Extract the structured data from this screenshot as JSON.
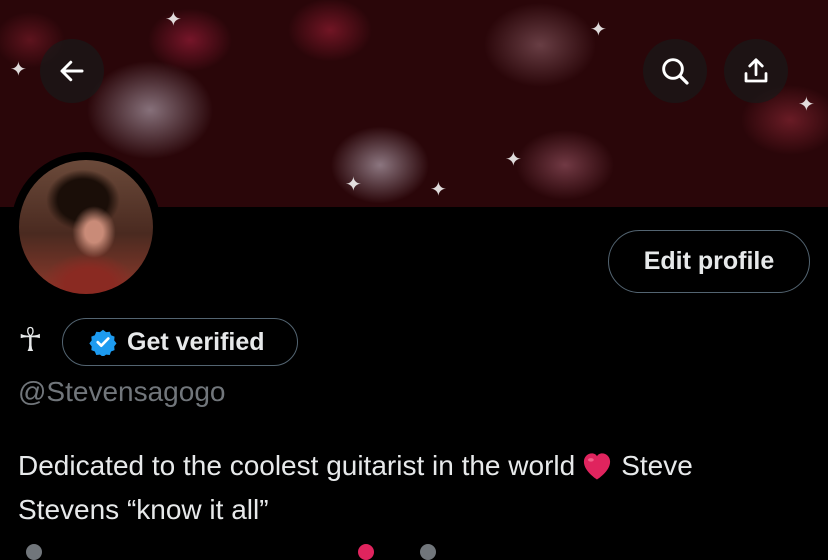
{
  "header": {
    "back_icon": "arrow-left-icon",
    "search_icon": "search-icon",
    "share_icon": "share-icon"
  },
  "profile": {
    "display_name": "☥",
    "verified_button_label": "Get verified",
    "verified_icon": "verified-badge-icon",
    "handle": "@Stevensagogo",
    "edit_button_label": "Edit profile",
    "bio_part1": "Dedicated to the coolest guitarist in the world",
    "bio_emoji": "heart-emoji",
    "bio_part2": "Steve",
    "bio_line2": "Stevens “know it all”"
  },
  "colors": {
    "background": "#000000",
    "text_primary": "#e7e9ea",
    "text_secondary": "#71767b",
    "border": "#536471",
    "verified_blue": "#1d9bf0",
    "heart_red": "#e0245e"
  }
}
